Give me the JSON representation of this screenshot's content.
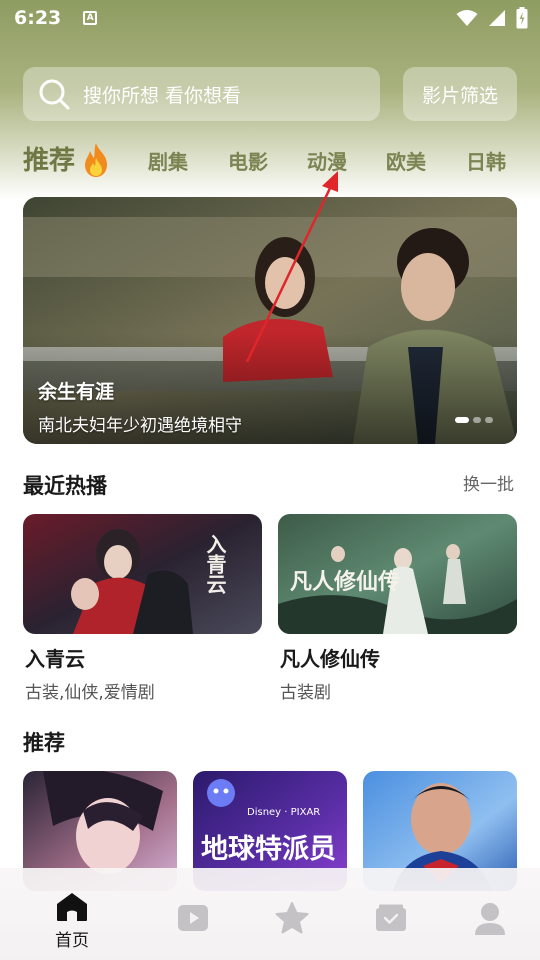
{
  "status_bar": {
    "time": "6:23",
    "a_badge": "A"
  },
  "search": {
    "placeholder": "搜你所想 看你想看",
    "filter_label": "影片筛选"
  },
  "tabs": [
    {
      "label": "推荐",
      "active": true
    },
    {
      "label": "剧集"
    },
    {
      "label": "电影"
    },
    {
      "label": "动漫"
    },
    {
      "label": "欧美"
    },
    {
      "label": "日韩"
    }
  ],
  "banner": {
    "title": "余生有涯",
    "subtitle": "南北夫妇年少初遇绝境相守",
    "page_count": 3,
    "active_index": 0
  },
  "recent": {
    "title": "最近热播",
    "refresh_label": "换一批",
    "items": [
      {
        "name": "入青云",
        "tags": "古装,仙侠,爱情剧",
        "poster_text": "入青云"
      },
      {
        "name": "凡人修仙传",
        "tags": "古装剧",
        "poster_text": "凡人修仙传"
      }
    ]
  },
  "recommend": {
    "title": "推荐",
    "items": [
      {
        "poster_text": ""
      },
      {
        "poster_text": "地球特派员",
        "brand": "Disney · PIXAR"
      },
      {
        "poster_text": ""
      }
    ]
  },
  "bottom_nav": [
    {
      "label": "首页",
      "icon": "home-icon",
      "active": true
    },
    {
      "label": "",
      "icon": "video-icon"
    },
    {
      "label": "",
      "icon": "star-icon"
    },
    {
      "label": "",
      "icon": "wallet-icon"
    },
    {
      "label": "",
      "icon": "user-icon"
    }
  ],
  "colors": {
    "header_green": "#8e9d62",
    "tab_text": "#7b8452",
    "annotation_arrow": "#e0262b"
  }
}
